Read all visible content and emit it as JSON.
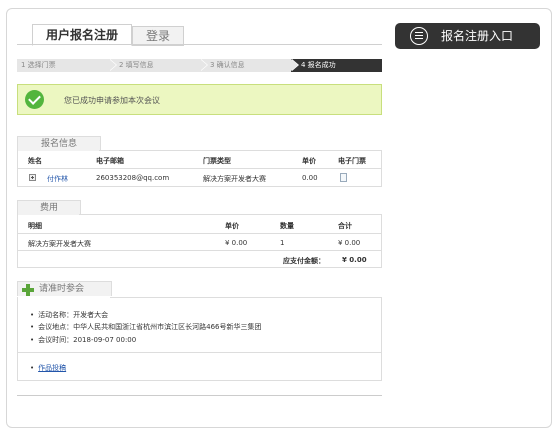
{
  "header": {
    "tabs": [
      {
        "label": "用户报名注册"
      },
      {
        "label": "登录"
      }
    ],
    "register_button": "报名注册入口"
  },
  "steps": [
    {
      "label": "1 选择门票"
    },
    {
      "label": "2 填写信息"
    },
    {
      "label": "3 确认信息"
    },
    {
      "label": "4 报名成功"
    }
  ],
  "success_message": "您已成功申请参加本次会议",
  "registration": {
    "title": "报名信息",
    "columns": [
      "姓名",
      "电子邮箱",
      "门票类型",
      "单价",
      "电子门票"
    ],
    "row": {
      "name": "付作林",
      "email": "260353208@qq.com",
      "ticket_type": "解决方案开发者大赛",
      "price": "0.00"
    }
  },
  "fees": {
    "title": "费用",
    "columns": [
      "明细",
      "单价",
      "数量",
      "合计"
    ],
    "row": {
      "item": "解决方案开发者大赛",
      "price": "¥ 0.00",
      "qty": "1",
      "total": "¥ 0.00"
    },
    "total_label": "应支付金额：",
    "total_value": "¥  0.00"
  },
  "attend": {
    "title": "请准时参会",
    "lines": [
      "活动名称：开发者大会",
      "会议地点：中华人民共和国浙江省杭州市滨江区长河路466号新华三集团",
      "会议时间：2018-09-07 00:00"
    ],
    "link": "作品投稿"
  }
}
